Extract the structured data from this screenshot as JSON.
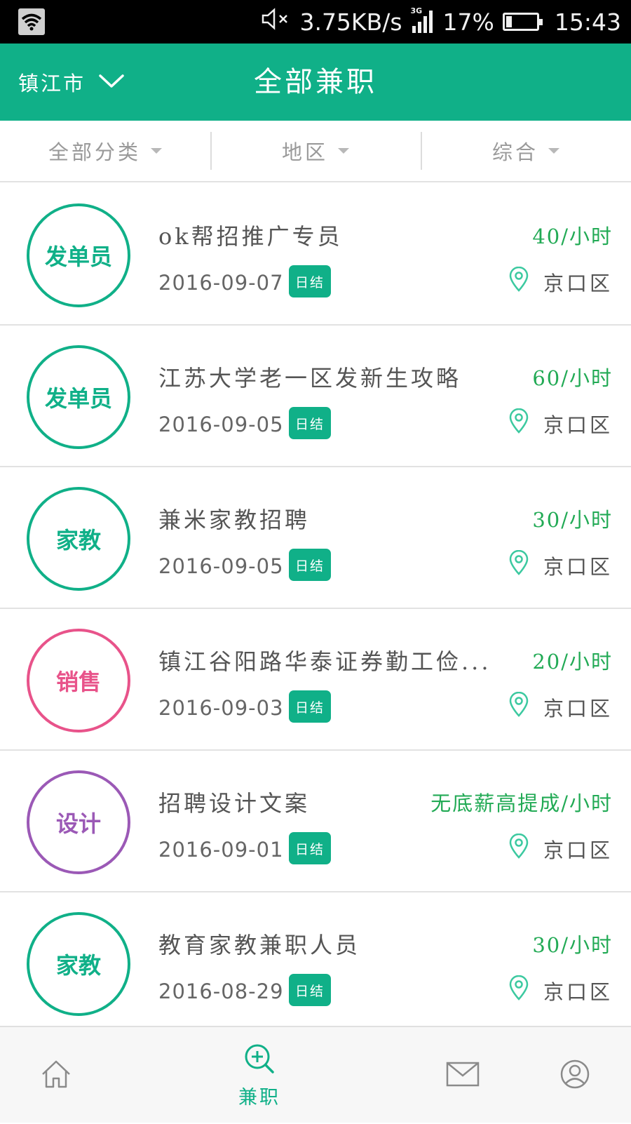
{
  "status_bar": {
    "speed": "3.75KB/s",
    "network": "3G",
    "battery": "17%",
    "battery_level": 0.17,
    "time": "15:43"
  },
  "header": {
    "city": "镇江市",
    "title": "全部兼职"
  },
  "filters": [
    {
      "label": "全部分类"
    },
    {
      "label": "地区"
    },
    {
      "label": "综合"
    }
  ],
  "jobs": [
    {
      "category": "发单员",
      "category_color": "#10b088",
      "title": "ok帮招推广专员",
      "date": "2016-09-07",
      "tag": "日结",
      "pay": "40/小时",
      "district": "京口区"
    },
    {
      "category": "发单员",
      "category_color": "#10b088",
      "title": "江苏大学老一区发新生攻略",
      "date": "2016-09-05",
      "tag": "日结",
      "pay": "60/小时",
      "district": "京口区"
    },
    {
      "category": "家教",
      "category_color": "#10b088",
      "title": "兼米家教招聘",
      "date": "2016-09-05",
      "tag": "日结",
      "pay": "30/小时",
      "district": "京口区"
    },
    {
      "category": "销售",
      "category_color": "#e8538a",
      "title": "镇江谷阳路华泰证券勤工俭...",
      "date": "2016-09-03",
      "tag": "日结",
      "pay": "20/小时",
      "district": "京口区"
    },
    {
      "category": "设计",
      "category_color": "#9b59b6",
      "title": "招聘设计文案",
      "date": "2016-09-01",
      "tag": "日结",
      "pay": "无底薪高提成/小时",
      "district": "京口区"
    },
    {
      "category": "家教",
      "category_color": "#10b088",
      "title": "教育家教兼职人员",
      "date": "2016-08-29",
      "tag": "日结",
      "pay": "30/小时",
      "district": "京口区"
    }
  ],
  "tab_bar": {
    "active_label": "兼职"
  },
  "colors": {
    "brand": "#10b088",
    "pay": "#22aa55"
  }
}
